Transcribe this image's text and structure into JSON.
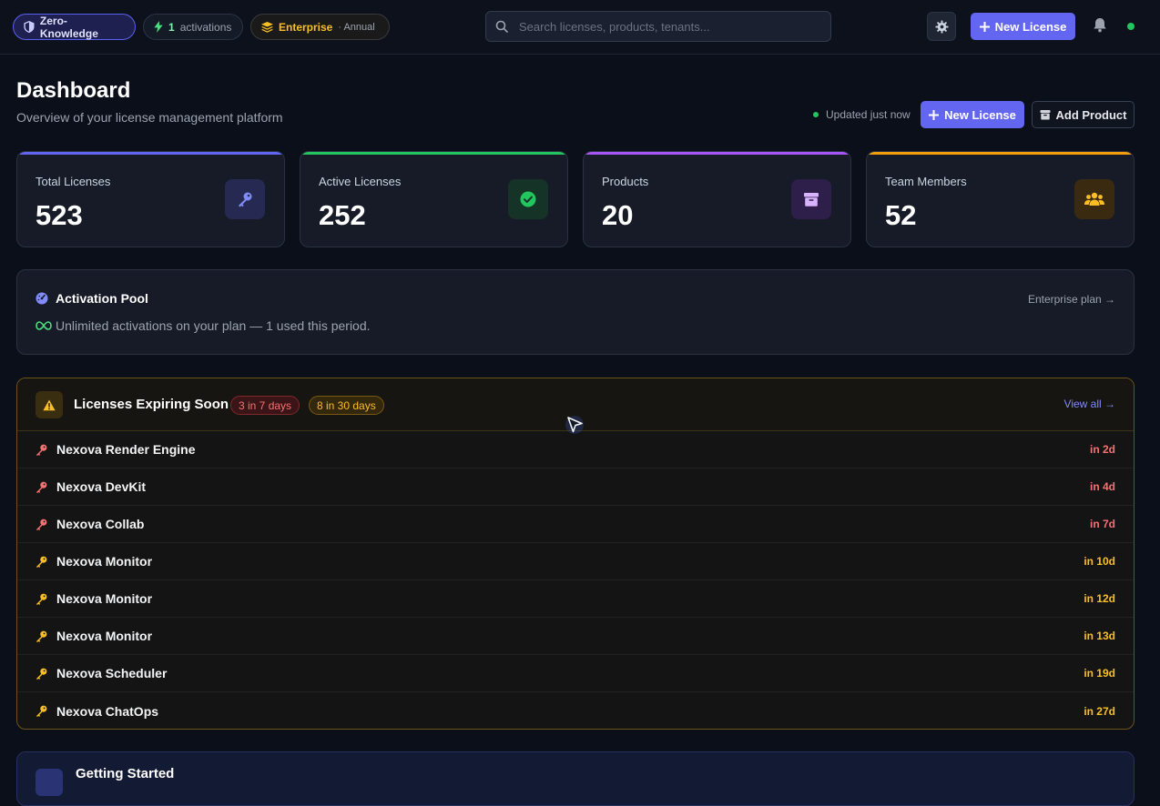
{
  "topbar": {
    "zk_label": "Zero-Knowledge",
    "activations_count": "1",
    "activations_label": "activations",
    "plan_name": "Enterprise",
    "plan_period": "· Annual",
    "search_placeholder": "Search licenses, products, tenants...",
    "new_license_label": "New License"
  },
  "header": {
    "title": "Dashboard",
    "subtitle": "Overview of your license management platform",
    "updated": "Updated just now",
    "new_license_label": "New License",
    "add_product_label": "Add Product"
  },
  "stats": [
    {
      "label": "Total Licenses",
      "value": "523",
      "accent": "#6366f1",
      "icon": "key-icon"
    },
    {
      "label": "Active Licenses",
      "value": "252",
      "accent": "#22c55e",
      "icon": "check-circle-icon"
    },
    {
      "label": "Products",
      "value": "20",
      "accent": "#a855f7",
      "icon": "box-icon"
    },
    {
      "label": "Team Members",
      "value": "52",
      "accent": "#f59e0b",
      "icon": "users-icon"
    }
  ],
  "pool": {
    "title": "Activation Pool",
    "text": "Unlimited activations on your plan — 1 used this period.",
    "link": "Enterprise plan →"
  },
  "expiring": {
    "title": "Licenses Expiring Soon",
    "tag_7": "3 in 7 days",
    "tag_30": "8 in 30 days",
    "view_all": "View all →",
    "items": [
      {
        "name": "Nexova Render Engine",
        "due": "in 2d",
        "severity": "urgent"
      },
      {
        "name": "Nexova DevKit",
        "due": "in 4d",
        "severity": "urgent"
      },
      {
        "name": "Nexova Collab",
        "due": "in 7d",
        "severity": "urgent"
      },
      {
        "name": "Nexova Monitor",
        "due": "in 10d",
        "severity": "soon"
      },
      {
        "name": "Nexova Monitor",
        "due": "in 12d",
        "severity": "soon"
      },
      {
        "name": "Nexova Monitor",
        "due": "in 13d",
        "severity": "soon"
      },
      {
        "name": "Nexova Scheduler",
        "due": "in 19d",
        "severity": "soon"
      },
      {
        "name": "Nexova ChatOps",
        "due": "in 27d",
        "severity": "soon"
      }
    ]
  },
  "getting_started": {
    "title": "Getting Started"
  },
  "colors": {
    "urgent": "#f87171",
    "soon": "#fbbf24",
    "primary": "#6366f1"
  }
}
